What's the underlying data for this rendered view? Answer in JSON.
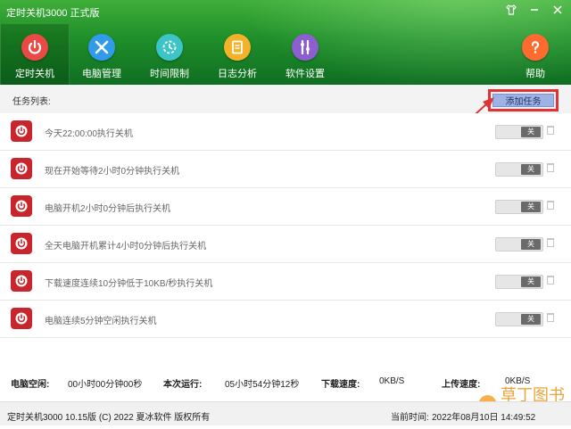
{
  "window": {
    "title": "定时关机3000 正式版"
  },
  "title_controls": [
    "shirt-icon",
    "minimize-icon",
    "close-icon"
  ],
  "nav": {
    "items": [
      {
        "label": "定时关机",
        "icon": "power-icon",
        "color": "#e94a45"
      },
      {
        "label": "电脑管理",
        "icon": "tools-icon",
        "color": "#2f9be9"
      },
      {
        "label": "时间限制",
        "icon": "timer-icon",
        "color": "#3cc5c7"
      },
      {
        "label": "日志分析",
        "icon": "document-icon",
        "color": "#f3b22a"
      },
      {
        "label": "软件设置",
        "icon": "settings-icon",
        "color": "#8b5fcf"
      },
      {
        "label": "帮助",
        "icon": "help-icon",
        "color": "#ff6a2f"
      }
    ]
  },
  "toolbar": {
    "label": "任务列表:",
    "add_button": "添加任务"
  },
  "tasks": [
    {
      "text": "今天22:00:00执行关机",
      "toggle": "关"
    },
    {
      "text": "现在开始等待2小时0分钟执行关机",
      "toggle": "关"
    },
    {
      "text": "电脑开机2小时0分钟后执行关机",
      "toggle": "关"
    },
    {
      "text": "全天电脑开机累计4小时0分钟后执行关机",
      "toggle": "关"
    },
    {
      "text": "下载速度连续10分钟低于10KB/秒执行关机",
      "toggle": "关"
    },
    {
      "text": "电脑连续5分钟空闲执行关机",
      "toggle": "关"
    }
  ],
  "status": {
    "idle_label": "电脑空闲:",
    "idle_value": "00小时00分钟00秒",
    "run_label": "本次运行:",
    "run_value": "05小时54分钟12秒",
    "download_label": "下载速度:",
    "download_value": "0KB/S",
    "upload_label": "上传速度:",
    "upload_value": "0KB/S"
  },
  "footer": {
    "version": "定时关机3000 10.15版 (C) 2022  夏冰软件 版权所有",
    "time_label": "当前时间:",
    "time_value": "2022年08月10日  14:49:52"
  },
  "watermark": {
    "text": "草丁图书馆"
  },
  "colors": {
    "header": "#1f8f2a",
    "highlight": "#e03333",
    "task_icon": "#c9252c"
  }
}
